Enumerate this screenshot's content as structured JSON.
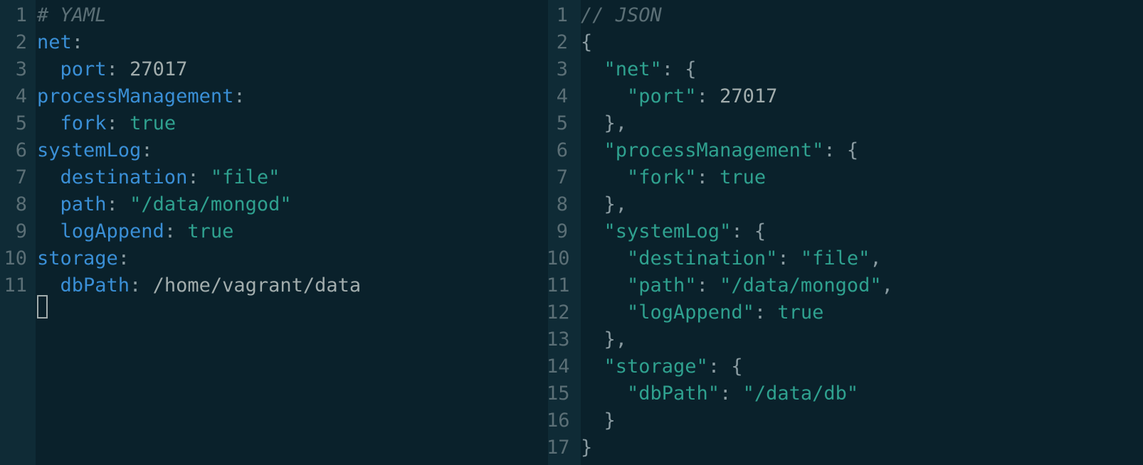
{
  "left_pane": {
    "lines": [
      {
        "n": "1",
        "tokens": [
          {
            "t": "# YAML",
            "c": "comment"
          }
        ]
      },
      {
        "n": "2",
        "tokens": [
          {
            "t": "net",
            "c": "key"
          },
          {
            "t": ":",
            "c": "punct"
          }
        ]
      },
      {
        "n": "3",
        "tokens": [
          {
            "t": "  port",
            "c": "key"
          },
          {
            "t": ": ",
            "c": "punct"
          },
          {
            "t": "27017",
            "c": "num"
          }
        ]
      },
      {
        "n": "4",
        "tokens": [
          {
            "t": "processManagement",
            "c": "key"
          },
          {
            "t": ":",
            "c": "punct"
          }
        ]
      },
      {
        "n": "5",
        "tokens": [
          {
            "t": "  fork",
            "c": "key"
          },
          {
            "t": ": ",
            "c": "punct"
          },
          {
            "t": "true",
            "c": "str"
          }
        ]
      },
      {
        "n": "6",
        "tokens": [
          {
            "t": "systemLog",
            "c": "key"
          },
          {
            "t": ":",
            "c": "punct"
          }
        ]
      },
      {
        "n": "7",
        "tokens": [
          {
            "t": "  destination",
            "c": "key"
          },
          {
            "t": ": ",
            "c": "punct"
          },
          {
            "t": "\"file\"",
            "c": "str"
          }
        ]
      },
      {
        "n": "8",
        "tokens": [
          {
            "t": "  path",
            "c": "key"
          },
          {
            "t": ": ",
            "c": "punct"
          },
          {
            "t": "\"/data/mongod\"",
            "c": "str"
          }
        ]
      },
      {
        "n": "9",
        "tokens": [
          {
            "t": "  logAppend",
            "c": "key"
          },
          {
            "t": ": ",
            "c": "punct"
          },
          {
            "t": "true",
            "c": "str"
          }
        ]
      },
      {
        "n": "10",
        "tokens": [
          {
            "t": "storage",
            "c": "key"
          },
          {
            "t": ":",
            "c": "punct"
          }
        ]
      },
      {
        "n": "11",
        "tokens": [
          {
            "t": "  dbPath",
            "c": "key"
          },
          {
            "t": ": ",
            "c": "punct"
          },
          {
            "t": "/home/vagrant/data",
            "c": "plain"
          }
        ]
      }
    ]
  },
  "right_pane": {
    "lines": [
      {
        "n": "1",
        "tokens": [
          {
            "t": "// JSON",
            "c": "comment"
          }
        ]
      },
      {
        "n": "2",
        "tokens": [
          {
            "t": "{",
            "c": "punct"
          }
        ]
      },
      {
        "n": "3",
        "tokens": [
          {
            "t": "  \"net\"",
            "c": "str"
          },
          {
            "t": ": {",
            "c": "punct"
          }
        ]
      },
      {
        "n": "4",
        "tokens": [
          {
            "t": "    \"port\"",
            "c": "str"
          },
          {
            "t": ": ",
            "c": "punct"
          },
          {
            "t": "27017",
            "c": "num"
          }
        ]
      },
      {
        "n": "5",
        "tokens": [
          {
            "t": "  },",
            "c": "punct"
          }
        ]
      },
      {
        "n": "6",
        "tokens": [
          {
            "t": "  \"processManagement\"",
            "c": "str"
          },
          {
            "t": ": {",
            "c": "punct"
          }
        ]
      },
      {
        "n": "7",
        "tokens": [
          {
            "t": "    \"fork\"",
            "c": "str"
          },
          {
            "t": ": ",
            "c": "punct"
          },
          {
            "t": "true",
            "c": "str"
          }
        ]
      },
      {
        "n": "8",
        "tokens": [
          {
            "t": "  },",
            "c": "punct"
          }
        ]
      },
      {
        "n": "9",
        "tokens": [
          {
            "t": "  \"systemLog\"",
            "c": "str"
          },
          {
            "t": ": {",
            "c": "punct"
          }
        ]
      },
      {
        "n": "10",
        "tokens": [
          {
            "t": "    \"destination\"",
            "c": "str"
          },
          {
            "t": ": ",
            "c": "punct"
          },
          {
            "t": "\"file\"",
            "c": "str"
          },
          {
            "t": ",",
            "c": "punct"
          }
        ]
      },
      {
        "n": "11",
        "tokens": [
          {
            "t": "    \"path\"",
            "c": "str"
          },
          {
            "t": ": ",
            "c": "punct"
          },
          {
            "t": "\"/data/mongod\"",
            "c": "str"
          },
          {
            "t": ",",
            "c": "punct"
          }
        ]
      },
      {
        "n": "12",
        "tokens": [
          {
            "t": "    \"logAppend\"",
            "c": "str"
          },
          {
            "t": ": ",
            "c": "punct"
          },
          {
            "t": "true",
            "c": "str"
          }
        ]
      },
      {
        "n": "13",
        "tokens": [
          {
            "t": "  },",
            "c": "punct"
          }
        ]
      },
      {
        "n": "14",
        "tokens": [
          {
            "t": "  \"storage\"",
            "c": "str"
          },
          {
            "t": ": {",
            "c": "punct"
          }
        ]
      },
      {
        "n": "15",
        "tokens": [
          {
            "t": "    \"dbPath\"",
            "c": "str"
          },
          {
            "t": ": ",
            "c": "punct"
          },
          {
            "t": "\"/data/db\"",
            "c": "str"
          }
        ]
      },
      {
        "n": "16",
        "tokens": [
          {
            "t": "  }",
            "c": "punct"
          }
        ]
      },
      {
        "n": "17",
        "tokens": [
          {
            "t": "}",
            "c": "punct"
          }
        ]
      }
    ]
  },
  "colors": {
    "background": "#0a212b",
    "gutter": "#0f2b36",
    "key": "#3a8fd6",
    "string": "#2fa18f",
    "number": "#a2adad",
    "comment": "#5b6f76"
  }
}
